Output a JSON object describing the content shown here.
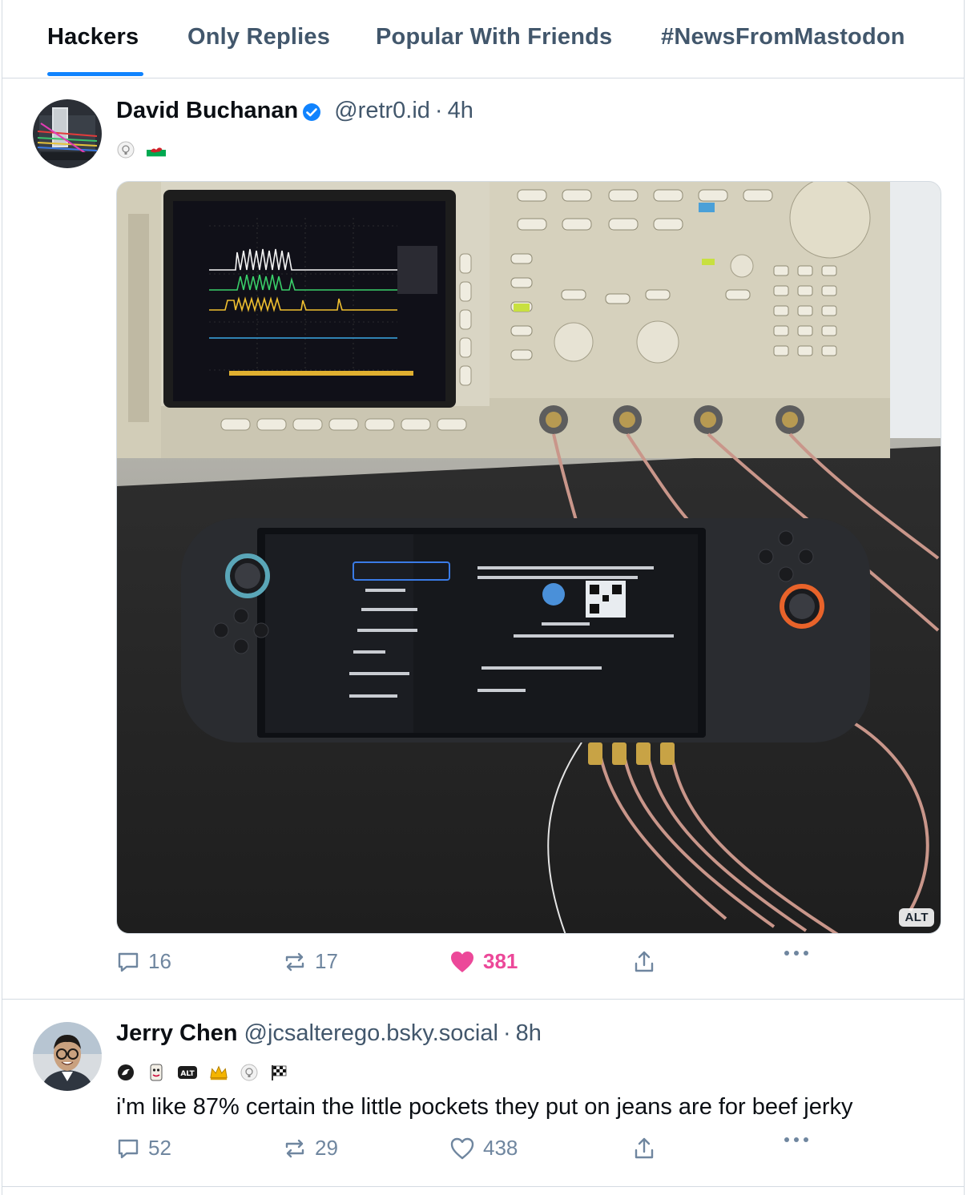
{
  "tabs": [
    {
      "label": "Hackers",
      "active": true
    },
    {
      "label": "Only Replies",
      "active": false
    },
    {
      "label": "Popular With Friends",
      "active": false
    },
    {
      "label": "#NewsFromMastodon",
      "active": false
    }
  ],
  "colors": {
    "accent": "#1083fe",
    "like": "#ec4899",
    "muted": "#42576c",
    "icon": "#6f869f",
    "divider": "#d4dbe2"
  },
  "posts": [
    {
      "author": {
        "display_name": "David Buchanan",
        "handle": "@retr0.id",
        "verified": true,
        "avatar": "avatar-circuit-board"
      },
      "time": "4h",
      "separator": "·",
      "badges": [
        "lightbulb-badge",
        "welsh-flag-badge"
      ],
      "media": {
        "type": "photo",
        "alt_label": "ALT",
        "subject": "oscilloscope-and-handheld-console"
      },
      "stats": {
        "replies": "16",
        "reposts": "17",
        "likes": "381",
        "liked": true
      }
    },
    {
      "author": {
        "display_name": "Jerry Chen",
        "handle": "@jcsalterego.bsky.social",
        "verified": false,
        "avatar": "avatar-person-glasses"
      },
      "time": "8h",
      "separator": "·",
      "badges": [
        "bird-badge",
        "mask-badge",
        "alt-badge",
        "crown-badge",
        "lightbulb-badge",
        "checkered-flag-badge"
      ],
      "text": "i'm like 87% certain the little pockets they put on jeans are for beef jerky",
      "stats": {
        "replies": "52",
        "reposts": "29",
        "likes": "438",
        "liked": false
      }
    }
  ]
}
